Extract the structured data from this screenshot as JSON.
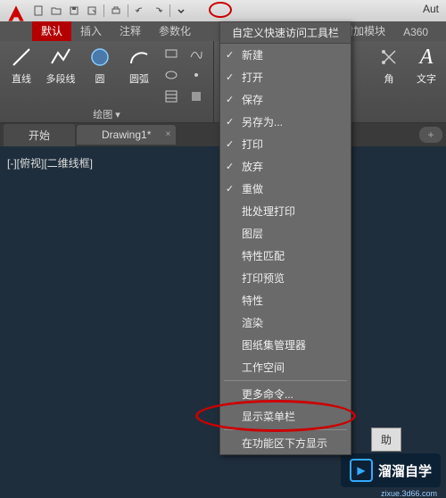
{
  "app": {
    "title_partial": "Aut"
  },
  "ribbon": {
    "tabs": [
      "默认",
      "插入",
      "注释",
      "参数化",
      "附加模块",
      "A360"
    ],
    "tools": {
      "line": "直线",
      "polyline": "多段线",
      "circle": "圆",
      "arc": "圆弧",
      "text": "文字",
      "angle": "角"
    },
    "panel_draw": "绘图 ▾"
  },
  "doc_tabs": {
    "start": "开始",
    "drawing": "Drawing1*",
    "add": "+"
  },
  "viewport": {
    "label": "[-][俯视][二维线框]"
  },
  "qat_menu": {
    "header": "自定义快速访问工具栏",
    "items": [
      {
        "label": "新建",
        "checked": true
      },
      {
        "label": "打开",
        "checked": true
      },
      {
        "label": "保存",
        "checked": true
      },
      {
        "label": "另存为...",
        "checked": true
      },
      {
        "label": "打印",
        "checked": true
      },
      {
        "label": "放弃",
        "checked": true
      },
      {
        "label": "重做",
        "checked": true
      },
      {
        "label": "批处理打印",
        "checked": false
      },
      {
        "label": "图层",
        "checked": false
      },
      {
        "label": "特性匹配",
        "checked": false
      },
      {
        "label": "打印预览",
        "checked": false
      },
      {
        "label": "特性",
        "checked": false
      },
      {
        "label": "渲染",
        "checked": false
      },
      {
        "label": "图纸集管理器",
        "checked": false
      },
      {
        "label": "工作空间",
        "checked": false
      }
    ],
    "footer": [
      "更多命令...",
      "显示菜单栏",
      "在功能区下方显示"
    ]
  },
  "watermark": {
    "brand": "溜溜自学",
    "url": "zixue.3d66.com",
    "play": "▶"
  },
  "help": {
    "label": "助"
  }
}
